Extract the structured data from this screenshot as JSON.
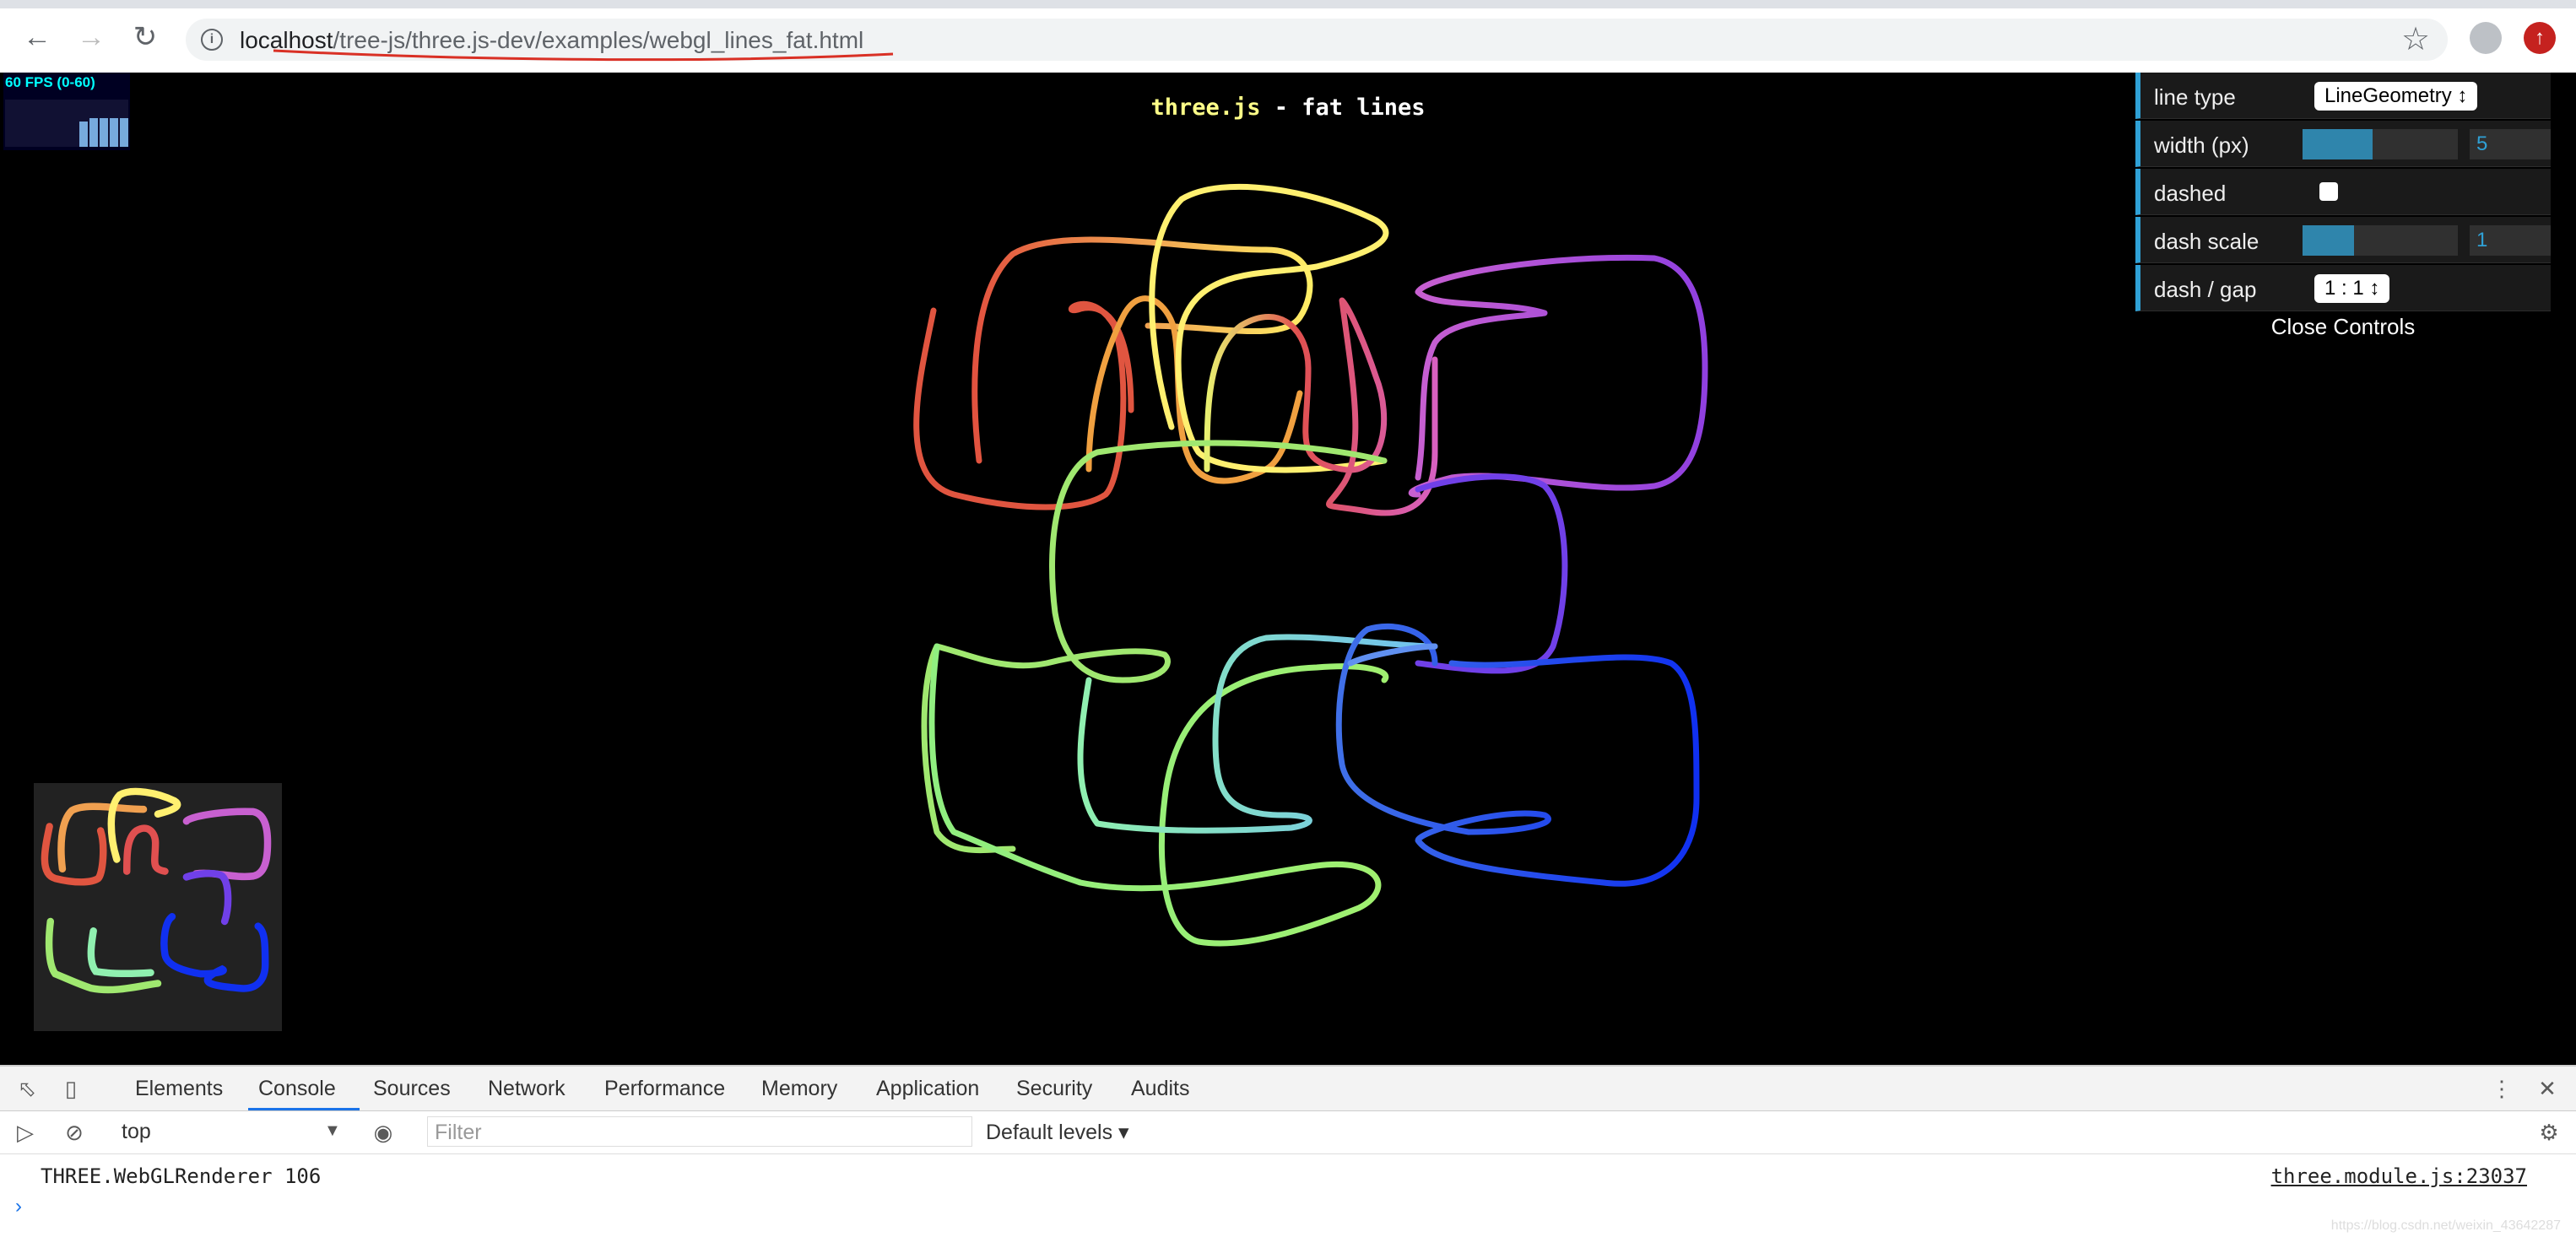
{
  "browser": {
    "url_host": "localhost",
    "url_path": "/tree-js/three.js-dev/examples/webgl_lines_fat.html"
  },
  "stats": {
    "fps_label": "60 FPS (0-60)"
  },
  "page": {
    "title_link": "three.js",
    "title_rest": " - fat lines"
  },
  "gui": {
    "line_type_label": "line type",
    "line_type_value": "LineGeometry ↕",
    "width_label": "width (px)",
    "width_value": "5",
    "width_fraction": 0.45,
    "dashed_label": "dashed",
    "dashed_checked": false,
    "dash_scale_label": "dash scale",
    "dash_scale_value": "1",
    "dash_scale_fraction": 0.33,
    "dash_gap_label": "dash / gap",
    "dash_gap_value": "1 : 1 ↕",
    "close_label": "Close Controls"
  },
  "devtools": {
    "tabs": [
      "Elements",
      "Console",
      "Sources",
      "Network",
      "Performance",
      "Memory",
      "Application",
      "Security",
      "Audits"
    ],
    "active_tab": "Console",
    "context": "top",
    "filter_placeholder": "Filter",
    "levels": "Default levels ▾",
    "log_message": "THREE.WebGLRenderer 106",
    "log_source": "three.module.js:23037",
    "watermark": "https://blog.csdn.net/weixin_43642287"
  },
  "colors": {
    "accent": "#2fa1d6",
    "title_link": "#ffff88",
    "url_underline": "#d93025"
  }
}
